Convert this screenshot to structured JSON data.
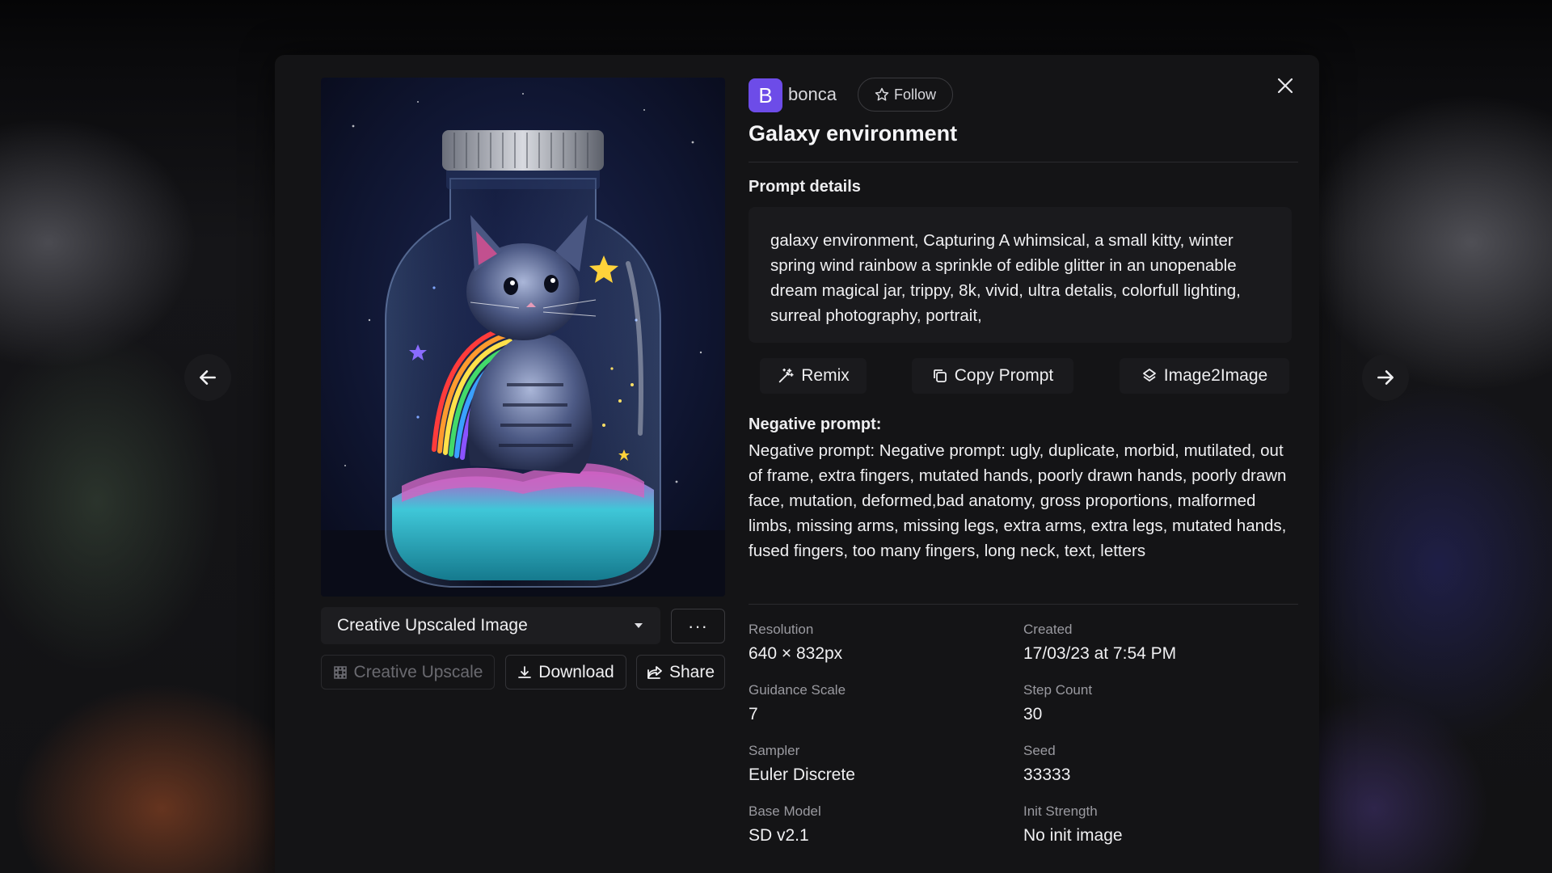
{
  "user": {
    "avatar_letter": "B",
    "name": "bonca",
    "follow_label": "Follow"
  },
  "title": "Galaxy environment",
  "prompt_section": {
    "label": "Prompt details",
    "text": "galaxy environment, Capturing A whimsical, a small kitty, winter spring wind rainbow a sprinkle of edible glitter in an unopenable dream magical jar, trippy, 8k, vivid, ultra detalis, colorfull lighting, surreal photography, portrait,",
    "buttons": {
      "remix": "Remix",
      "copy": "Copy Prompt",
      "image2image": "Image2Image"
    }
  },
  "negative_section": {
    "label": "Negative prompt:",
    "text": "Negative prompt: Negative prompt: ugly, duplicate, morbid, mutilated, out of frame, extra fingers, mutated hands, poorly drawn hands, poorly drawn face, mutation, deformed,bad anatomy, gross proportions, malformed limbs, missing arms, missing legs, extra arms, extra legs, mutated hands, fused fingers, too many fingers, long neck, text, letters"
  },
  "metadata": [
    {
      "label": "Resolution",
      "value": "640 × 832px"
    },
    {
      "label": "Created",
      "value": "17/03/23 at 7:54 PM"
    },
    {
      "label": "Guidance Scale",
      "value": "7"
    },
    {
      "label": "Step Count",
      "value": "30"
    },
    {
      "label": "Sampler",
      "value": "Euler Discrete"
    },
    {
      "label": "Seed",
      "value": "33333"
    },
    {
      "label": "Base Model",
      "value": "SD v2.1"
    },
    {
      "label": "Init Strength",
      "value": "No init image"
    }
  ],
  "image_panel": {
    "variant_selected": "Creative Upscaled Image",
    "more_label": "···",
    "buttons": {
      "upscale": "Creative Upscale",
      "download": "Download",
      "share": "Share"
    }
  },
  "colors": {
    "accent": "#6d4ce8",
    "panel": "#141416",
    "surface": "#1a1a1d"
  }
}
